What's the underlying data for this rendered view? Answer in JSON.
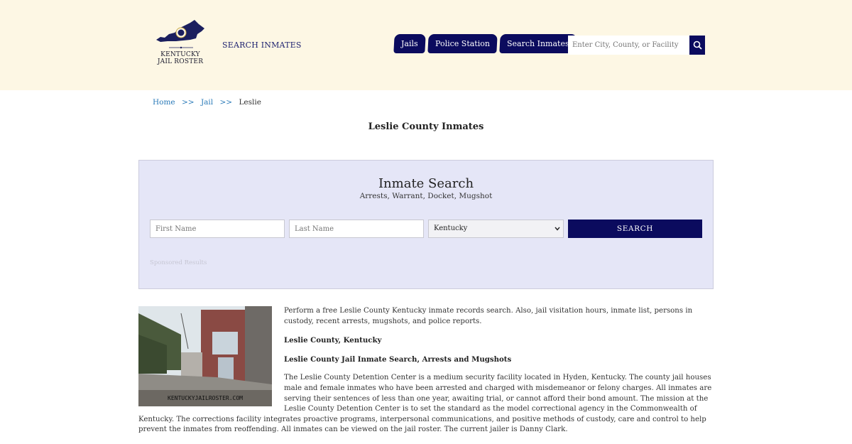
{
  "header": {
    "logo_line1": "KENTUCKY",
    "logo_line2": "JAIL ROSTER",
    "search_inmates_link": "SEARCH INMATES",
    "nav": [
      {
        "label": "Jails"
      },
      {
        "label": "Police Station"
      },
      {
        "label": "Search Inmates"
      }
    ],
    "search_placeholder": "Enter City, County, or Facility"
  },
  "breadcrumb": {
    "home": "Home",
    "sep": ">>",
    "jail": "Jail",
    "current": "Leslie"
  },
  "page_title": "Leslie County Inmates",
  "panel": {
    "title": "Inmate Search",
    "subtitle": "Arrests, Warrant, Docket, Mugshot",
    "first_name_placeholder": "First Name",
    "last_name_placeholder": "Last Name",
    "state_selected": "Kentucky",
    "search_button": "Search",
    "sponsored": "Sponsored Results"
  },
  "photo_watermark": "KENTUCKYJAILROSTER.COM",
  "content": {
    "intro": "Perform a free Leslie County Kentucky inmate records search. Also, jail visitation hours, inmate list, persons in custody, recent arrests, mugshots, and police reports.",
    "heading1": "Leslie County, Kentucky",
    "heading2": "Leslie County Jail Inmate Search, Arrests and Mugshots",
    "body": "The Leslie County Detention Center is a medium security facility located in Hyden, Kentucky. The county jail houses male and female inmates who have been arrested and charged with misdemeanor or felony charges. All inmates are serving their sentences of less than one year, awaiting trial, or cannot afford their bond amount. The mission at the Leslie County Detention Center is to set the standard as the model correctional agency in the Commonwealth of Kentucky. The corrections facility integrates proactive programs, interpersonal communications, and positive methods of custody, care and control to help prevent the inmates from reoffending. All inmates can be viewed on the jail roster. The current jailer is Danny Clark."
  },
  "colors": {
    "header_bg": "#fdf7e4",
    "navy": "#0b0b5e",
    "panel_bg": "#e5e6f7",
    "link": "#2a7ab8"
  }
}
